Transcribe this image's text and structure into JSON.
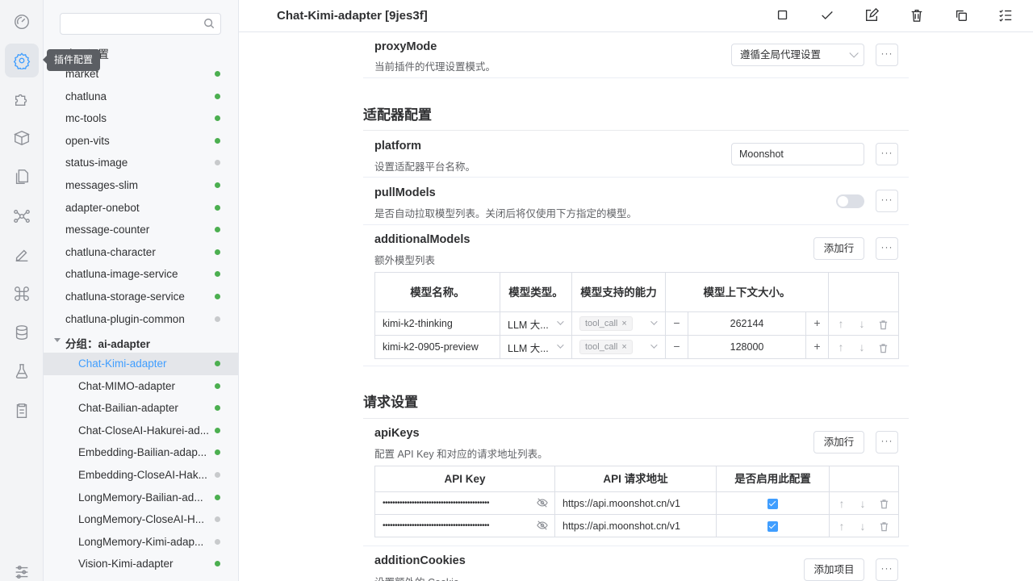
{
  "activity": {
    "tooltip": "插件配置",
    "items": [
      "dashboard-icon",
      "settings-icon",
      "puzzle-icon",
      "box-icon",
      "files-icon",
      "graph-icon",
      "edit-icon",
      "command-icon",
      "database-icon",
      "flask-icon",
      "clipboard-icon",
      "sliders-icon"
    ]
  },
  "sidebar": {
    "search_placeholder": "",
    "global_settings": "全局设置",
    "items": [
      {
        "label": "market",
        "status": "on"
      },
      {
        "label": "chatluna",
        "status": "on"
      },
      {
        "label": "mc-tools",
        "status": "on"
      },
      {
        "label": "open-vits",
        "status": "on"
      },
      {
        "label": "status-image",
        "status": "off"
      },
      {
        "label": "messages-slim",
        "status": "on"
      },
      {
        "label": "adapter-onebot",
        "status": "on"
      },
      {
        "label": "message-counter",
        "status": "on"
      },
      {
        "label": "chatluna-character",
        "status": "on"
      },
      {
        "label": "chatluna-image-service",
        "status": "on"
      },
      {
        "label": "chatluna-storage-service",
        "status": "on"
      },
      {
        "label": "chatluna-plugin-common",
        "status": "off"
      }
    ],
    "group_label": "分组：ai-adapter",
    "group_items": [
      {
        "label": "Chat-Kimi-adapter",
        "status": "on"
      },
      {
        "label": "Chat-MIMO-adapter",
        "status": "on"
      },
      {
        "label": "Chat-Bailian-adapter",
        "status": "on"
      },
      {
        "label": "Chat-CloseAI-Hakurei-ad...",
        "status": "on"
      },
      {
        "label": "Embedding-Bailian-adap...",
        "status": "on"
      },
      {
        "label": "Embedding-CloseAI-Hak...",
        "status": "off"
      },
      {
        "label": "LongMemory-Bailian-ad...",
        "status": "on"
      },
      {
        "label": "LongMemory-CloseAI-H...",
        "status": "off"
      },
      {
        "label": "LongMemory-Kimi-adap...",
        "status": "off"
      },
      {
        "label": "Vision-Kimi-adapter",
        "status": "on"
      }
    ]
  },
  "header": {
    "title": "Chat-Kimi-adapter [9jes3f]"
  },
  "proxy": {
    "name": "proxyMode",
    "desc": "当前插件的代理设置模式。",
    "value": "遵循全局代理设置",
    "more": "···"
  },
  "adapter_section": {
    "title": "适配器配置",
    "platform": {
      "name": "platform",
      "desc": "设置适配器平台名称。",
      "value": "Moonshot"
    },
    "pull_models": {
      "name": "pullModels",
      "desc": "是否自动拉取模型列表。关闭后将仅使用下方指定的模型。"
    },
    "additional_models": {
      "name": "additionalModels",
      "desc": "额外模型列表",
      "add_row": "添加行",
      "columns": [
        "模型名称。",
        "模型类型。",
        "模型支持的能力",
        "模型上下文大小。"
      ],
      "rows": [
        {
          "name": "kimi-k2-thinking",
          "type": "LLM 大...",
          "capability": "tool_call",
          "context": "262144"
        },
        {
          "name": "kimi-k2-0905-preview",
          "type": "LLM 大...",
          "capability": "tool_call",
          "context": "128000"
        }
      ]
    }
  },
  "request_section": {
    "title": "请求设置",
    "api_keys": {
      "name": "apiKeys",
      "desc": "配置 API Key 和对应的请求地址列表。",
      "add_row": "添加行",
      "columns": [
        "API Key",
        "API 请求地址",
        "是否启用此配置"
      ],
      "rows": [
        {
          "key": "••••••••••••••••••••••••••••••••••••••••••••",
          "url": "https://api.moonshot.cn/v1",
          "enabled": true
        },
        {
          "key": "••••••••••••••••••••••••••••••••••••••••••••",
          "url": "https://api.moonshot.cn/v1",
          "enabled": true
        }
      ]
    },
    "addition_cookies": {
      "name": "additionCookies",
      "desc": "设置额外的 Cookie",
      "add_item": "添加项目"
    }
  }
}
